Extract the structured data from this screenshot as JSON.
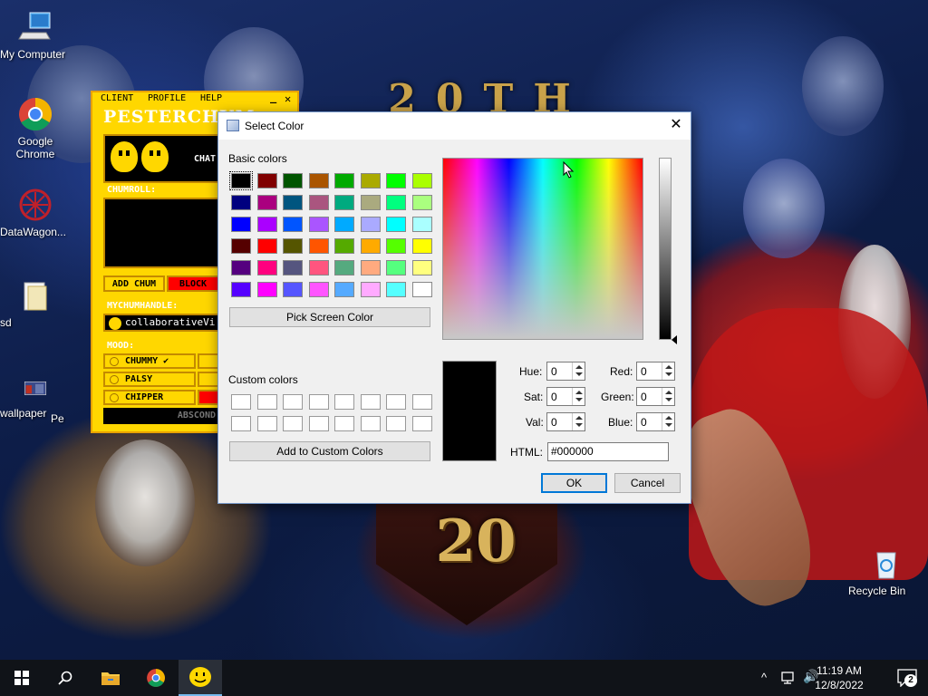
{
  "desktop": {
    "icons": [
      {
        "name": "my-computer-icon",
        "label": "My Computer"
      },
      {
        "name": "google-chrome-icon",
        "label": "Google Chrome"
      },
      {
        "name": "datawagon-icon",
        "label": "DataWagon..."
      },
      {
        "name": "sd-folder-icon",
        "label": "sd"
      },
      {
        "name": "wallpaper-icon",
        "label": "wallpaper"
      },
      {
        "name": "pesterchum-shortcut-icon",
        "label": "Pe"
      },
      {
        "name": "recycle-bin-icon",
        "label": "Recycle Bin"
      }
    ],
    "wallpaper_text": "20TH ANNUAL",
    "wallpaper_number": "20"
  },
  "pesterchum": {
    "menu": [
      "CLIENT",
      "PROFILE",
      "HELP"
    ],
    "min_glyph": "_",
    "close_glyph": "✕",
    "title": "PESTERCHUM",
    "chat_label": "CHAT",
    "chumroll_label": "CHUMROLL:",
    "add_chum_label": "ADD CHUM",
    "block_label": "BLOCK",
    "mychumhandle_label": "MYCHUMHANDLE:",
    "handle_value": "collaborativeVi",
    "mood_label": "MOOD:",
    "moods": [
      "CHUMMY ✔",
      "PALSY",
      "CHIPPER"
    ],
    "abscond_label": "ABSCOND",
    "colors": {
      "bg": "#ffd700",
      "border": "#e8a200",
      "block": "#ff0000"
    }
  },
  "dialog": {
    "title": "Select Color",
    "close_glyph": "✕",
    "basic_colors_label": "Basic colors",
    "basic_colors": [
      [
        "#000000",
        "#800000",
        "#005500",
        "#aa5500",
        "#00aa00",
        "#aaaa00",
        "#00ff00",
        "#aaff00"
      ],
      [
        "#00007f",
        "#aa007f",
        "#00557f",
        "#aa557f",
        "#00aa7f",
        "#aaaa7f",
        "#00ff7f",
        "#aaff7f"
      ],
      [
        "#0000ff",
        "#aa00ff",
        "#0055ff",
        "#aa55ff",
        "#00aaff",
        "#aaaaff",
        "#00ffff",
        "#aaffff"
      ],
      [
        "#550000",
        "#ff0000",
        "#555500",
        "#ff5500",
        "#55aa00",
        "#ffaa00",
        "#55ff00",
        "#ffff00"
      ],
      [
        "#55007f",
        "#ff007f",
        "#55557f",
        "#ff557f",
        "#55aa7f",
        "#ffaa7f",
        "#55ff7f",
        "#ffff7f"
      ],
      [
        "#5500ff",
        "#ff00ff",
        "#5555ff",
        "#ff55ff",
        "#55aaff",
        "#ffaaff",
        "#55ffff",
        "#ffffff"
      ]
    ],
    "pick_screen_color_label": "Pick Screen Color",
    "custom_colors_label": "Custom colors",
    "add_custom_label": "Add to Custom Colors",
    "fields": {
      "hue": {
        "label": "Hue:",
        "value": "0"
      },
      "sat": {
        "label": "Sat:",
        "value": "0"
      },
      "val": {
        "label": "Val:",
        "value": "0"
      },
      "red": {
        "label": "Red:",
        "value": "0"
      },
      "green": {
        "label": "Green:",
        "value": "0"
      },
      "blue": {
        "label": "Blue:",
        "value": "0"
      }
    },
    "html_label": "HTML:",
    "html_value": "#000000",
    "ok_label": "OK",
    "cancel_label": "Cancel",
    "current_color": "#000000"
  },
  "taskbar": {
    "time": "11:19 AM",
    "date": "12/8/2022",
    "notification_count": "2",
    "pinned": [
      "start-button",
      "search-button",
      "file-explorer-button",
      "chrome-button",
      "pesterchum-button"
    ],
    "tray_glyphs": {
      "chevron": "^",
      "volume": "🔊"
    }
  }
}
